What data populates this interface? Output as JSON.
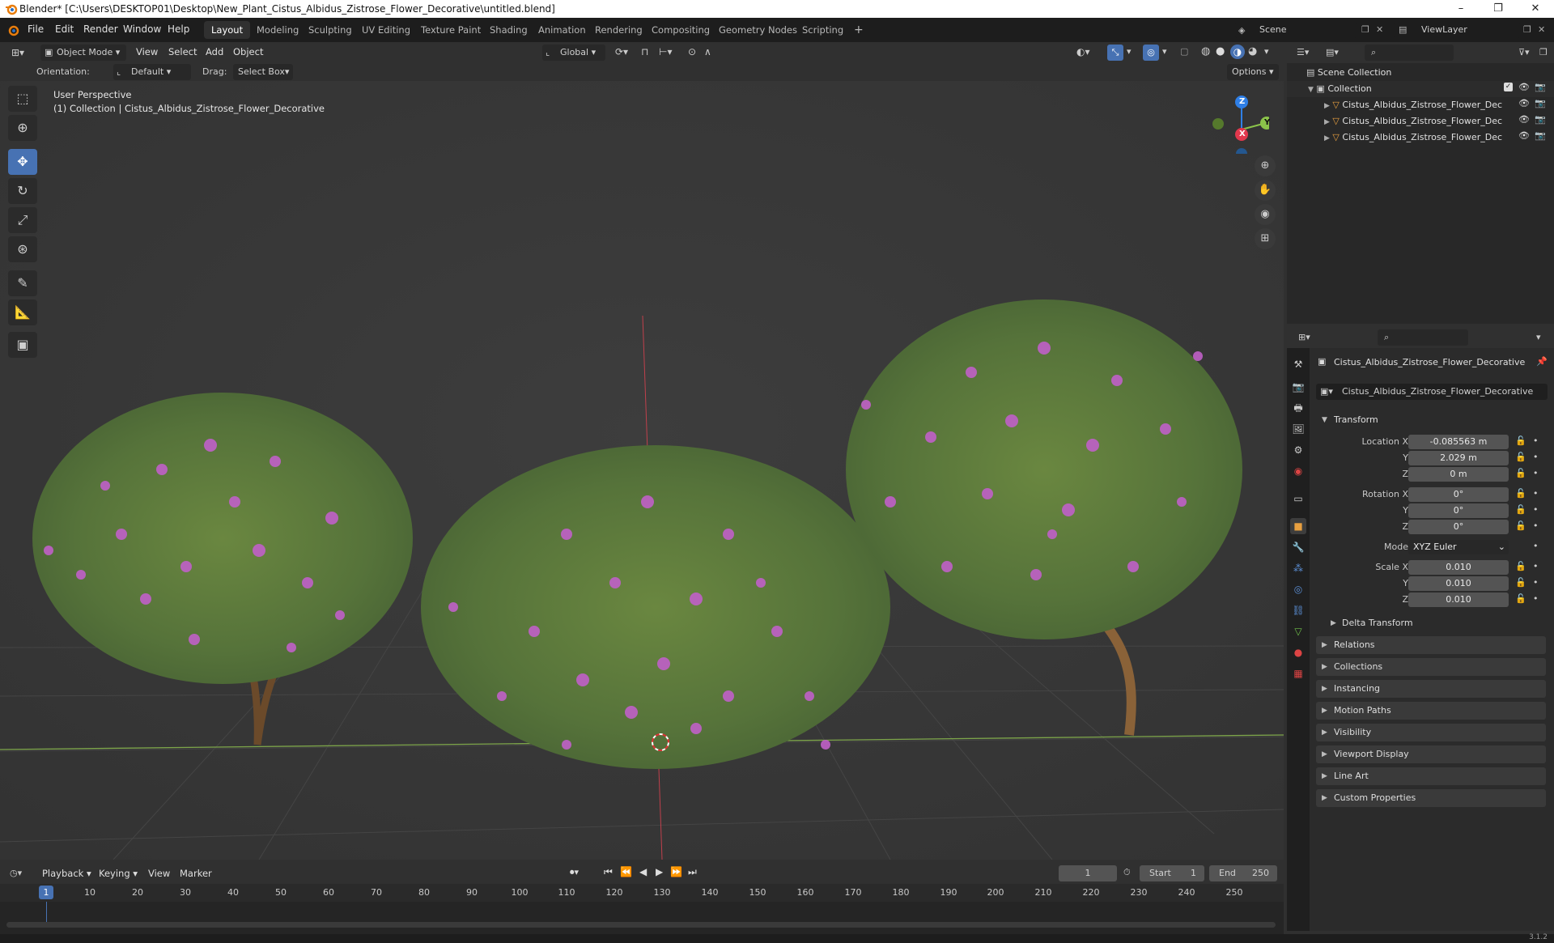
{
  "window": {
    "title": "Blender* [C:\\Users\\DESKTOP01\\Desktop\\New_Plant_Cistus_Albidus_Zistrose_Flower_Decorative\\untitled.blend]",
    "minimize": "–",
    "maximize": "❐",
    "close": "✕"
  },
  "menu": [
    "File",
    "Edit",
    "Render",
    "Window",
    "Help"
  ],
  "workspaces": [
    "Layout",
    "Modeling",
    "Sculpting",
    "UV Editing",
    "Texture Paint",
    "Shading",
    "Animation",
    "Rendering",
    "Compositing",
    "Geometry Nodes",
    "Scripting",
    "+"
  ],
  "active_workspace": "Layout",
  "scene": {
    "name": "Scene",
    "view_layer": "ViewLayer"
  },
  "viewport_header": {
    "mode": "Object Mode",
    "menus": [
      "View",
      "Select",
      "Add",
      "Object"
    ],
    "transform_orientation": "Global",
    "orientation_label": "Orientation:",
    "orientation_value": "Default",
    "drag_label": "Drag:",
    "drag_value": "Select Box",
    "options": "Options"
  },
  "viewport": {
    "perspective": "User Perspective",
    "collection_info": "(1) Collection | Cistus_Albidus_Zistrose_Flower_Decorative",
    "gizmo_axes": {
      "z": "Z",
      "y": "Y",
      "x": "X"
    }
  },
  "outliner": {
    "scene_collection": "Scene Collection",
    "collection": "Collection",
    "objects": [
      "Cistus_Albidus_Zistrose_Flower_Dec",
      "Cistus_Albidus_Zistrose_Flower_Dec",
      "Cistus_Albidus_Zistrose_Flower_Dec"
    ]
  },
  "properties": {
    "object_name": "Cistus_Albidus_Zistrose_Flower_Decorative",
    "object_field": "Cistus_Albidus_Zistrose_Flower_Decorative",
    "transform_label": "Transform",
    "location": {
      "label": "Location X",
      "x": "-0.085563 m",
      "y": "2.029 m",
      "z": "0 m"
    },
    "rotation": {
      "label": "Rotation X",
      "x": "0°",
      "y": "0°",
      "z": "0°"
    },
    "mode": {
      "label": "Mode",
      "value": "XYZ Euler"
    },
    "scale": {
      "label": "Scale X",
      "x": "0.010",
      "y": "0.010",
      "z": "0.010"
    },
    "axis_y": "Y",
    "axis_z": "Z",
    "delta_transform": "Delta Transform",
    "sections": [
      "Relations",
      "Collections",
      "Instancing",
      "Motion Paths",
      "Visibility",
      "Viewport Display",
      "Line Art",
      "Custom Properties"
    ]
  },
  "timeline": {
    "menus": [
      "Playback",
      "Keying",
      "View",
      "Marker"
    ],
    "current_frame": "1",
    "start_label": "Start",
    "start": "1",
    "end_label": "End",
    "end": "250",
    "ticks": [
      "1",
      "10",
      "20",
      "30",
      "40",
      "50",
      "60",
      "70",
      "80",
      "90",
      "100",
      "110",
      "120",
      "130",
      "140",
      "150",
      "160",
      "170",
      "180",
      "190",
      "200",
      "210",
      "220",
      "230",
      "240",
      "250"
    ]
  },
  "status": {
    "version": "3.1.2"
  },
  "colors": {
    "accent": "#4772b3",
    "x_axis": "#e2384d",
    "y_axis": "#8bc34a",
    "z_axis": "#2f7fe6",
    "flower": "#c060c8",
    "foliage": "#5d7a3a"
  }
}
